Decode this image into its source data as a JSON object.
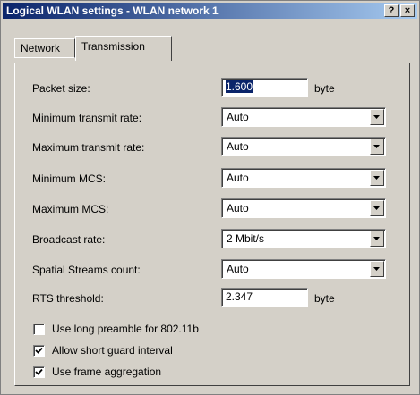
{
  "window": {
    "title": "Logical WLAN settings - WLAN network 1",
    "help_label": "?",
    "close_label": "×"
  },
  "tabs": [
    {
      "label": "Network",
      "active": false
    },
    {
      "label": "Transmission",
      "active": true
    }
  ],
  "fields": {
    "packet_size": {
      "label": "Packet size:",
      "value": "1.600",
      "unit": "byte"
    },
    "min_transmit_rate": {
      "label": "Minimum transmit rate:",
      "value": "Auto"
    },
    "max_transmit_rate": {
      "label": "Maximum transmit rate:",
      "value": "Auto"
    },
    "min_mcs": {
      "label": "Minimum MCS:",
      "value": "Auto"
    },
    "max_mcs": {
      "label": "Maximum MCS:",
      "value": "Auto"
    },
    "broadcast_rate": {
      "label": "Broadcast rate:",
      "value": "2 Mbit/s"
    },
    "spatial_streams": {
      "label": "Spatial Streams count:",
      "value": "Auto"
    },
    "rts_threshold": {
      "label": "RTS threshold:",
      "value": "2.347",
      "unit": "byte"
    }
  },
  "checkboxes": {
    "long_preamble": {
      "label": "Use long preamble for 802.11b",
      "checked": false
    },
    "short_guard": {
      "label": "Allow short guard interval",
      "checked": true
    },
    "frame_aggregation": {
      "label": "Use frame aggregation",
      "checked": true
    }
  },
  "icons": {
    "dropdown": "triangle-down-icon",
    "check": "checkmark-icon"
  },
  "colors": {
    "title_bar_start": "#0a246a",
    "title_bar_end": "#a6caf0",
    "face": "#d4d0c8",
    "selection": "#0a246a"
  }
}
